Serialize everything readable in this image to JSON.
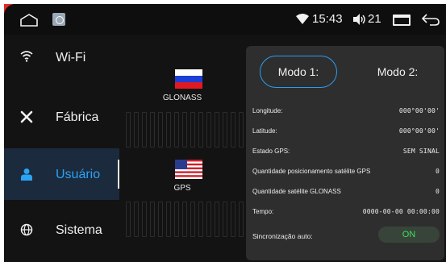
{
  "statusbar": {
    "time": "15:43",
    "volume": "21",
    "icons": [
      "home-icon",
      "gallery-icon",
      "wifi-icon",
      "volume-icon",
      "window-icon",
      "back-icon"
    ]
  },
  "sidebar": {
    "items": [
      {
        "label": "Wi-Fi",
        "icon": "wifi-icon",
        "active": false
      },
      {
        "label": "Fábrica",
        "icon": "tools-icon",
        "active": false
      },
      {
        "label": "Usuário",
        "icon": "user-icon",
        "active": true
      },
      {
        "label": "Sistema",
        "icon": "globe-icon",
        "active": false
      }
    ]
  },
  "satellites": {
    "glonass_label": "GLONASS",
    "gps_label": "GPS"
  },
  "modes": {
    "mode1": "Modo 1:",
    "mode2": "Modo 2:"
  },
  "info": {
    "longitude_label": "Longitude:",
    "longitude_value": "000°00'00'",
    "latitude_label": "Latitude:",
    "latitude_value": "000°00'00'",
    "gps_state_label": "Estado GPS:",
    "gps_state_value": "SEM SINAL",
    "gps_sat_pos_label": "Quantidade posicionamento satélite GPS",
    "gps_sat_pos_value": "0",
    "glonass_sat_label": "Quantidade satélite GLONASS",
    "glonass_sat_value": "0",
    "time_label": "Tempo:",
    "time_value": "0000-00-00 00:00:00",
    "sync_label": "Sincronização auto:",
    "sync_value": "ON"
  },
  "colors": {
    "accent": "#2aa4f4",
    "toggle_on": "#39e15a",
    "frame": "#e02a2a"
  }
}
